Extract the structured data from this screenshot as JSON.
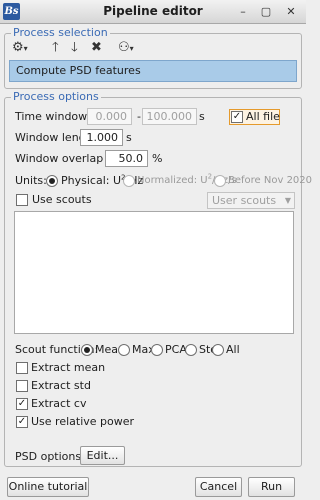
{
  "window": {
    "logo_text": "Bs",
    "title": "Pipeline editor",
    "controls": {
      "minimize": "–",
      "maximize": "▢",
      "close": "✕"
    }
  },
  "process_selection": {
    "legend": "Process selection",
    "toolbar": {
      "gear_menu_icon": "gear-icon",
      "move_up_icon": "arrow-up-icon",
      "move_down_icon": "arrow-down-icon",
      "delete_icon": "delete-icon",
      "pipeline_menu_icon": "pipeline-icon"
    },
    "selected_process": "Compute PSD features"
  },
  "process_options": {
    "legend": "Process options",
    "time_window": {
      "label": "Time window:",
      "start": "0.000",
      "separator": "-",
      "end": "100.000",
      "unit": "s",
      "all_file_label": "All file",
      "all_file_checked": true
    },
    "window_length": {
      "label": "Window length:",
      "value": "1.000",
      "unit": "s"
    },
    "window_overlap": {
      "label": "Window overlap ratio:",
      "value": "50.0",
      "unit": "%"
    },
    "units": {
      "label": "Units:",
      "physical_label": "Physical: U",
      "physical_sup": "2",
      "physical_suffix": "/Hz",
      "normalized_label": "Normalized: U",
      "normalized_sup": "2",
      "normalized_suffix": "/Hz/s",
      "before_label": "Before Nov 2020",
      "selected": "physical"
    },
    "use_scouts": {
      "label": "Use scouts",
      "checked": false,
      "combo_value": "User scouts"
    },
    "scout_function": {
      "label": "Scout function:",
      "options": [
        "Mean",
        "Max",
        "PCA",
        "Std",
        "All"
      ],
      "selected": "Mean"
    },
    "extract_mean": {
      "label": "Extract mean",
      "checked": false
    },
    "extract_std": {
      "label": "Extract std",
      "checked": false
    },
    "extract_cv": {
      "label": "Extract cv",
      "checked": true
    },
    "use_relative_power": {
      "label": "Use relative power",
      "checked": true
    },
    "psd_options": {
      "label": "PSD options:",
      "button": "Edit..."
    }
  },
  "footer": {
    "online_tutorial": "Online tutorial",
    "cancel": "Cancel",
    "run": "Run"
  }
}
